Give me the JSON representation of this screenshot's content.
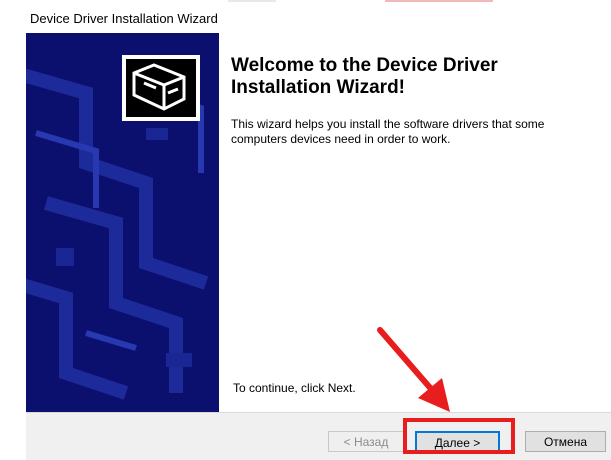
{
  "window": {
    "title": "Device Driver Installation Wizard"
  },
  "content": {
    "heading": "Welcome to the Device Driver Installation Wizard!",
    "description": "This wizard helps you install the software drivers that some computers devices need in order to work.",
    "continue_text": "To continue, click Next."
  },
  "buttons": {
    "back": "< Назад",
    "next": "Далее >",
    "cancel": "Отмена"
  },
  "colors": {
    "sidebar": "#0b0f6e",
    "highlight": "#e81d1d",
    "focus": "#0078d7"
  },
  "icons": {
    "wizard_logo": "hardware-device-icon",
    "annotation_arrow": "red-arrow-annotation"
  }
}
